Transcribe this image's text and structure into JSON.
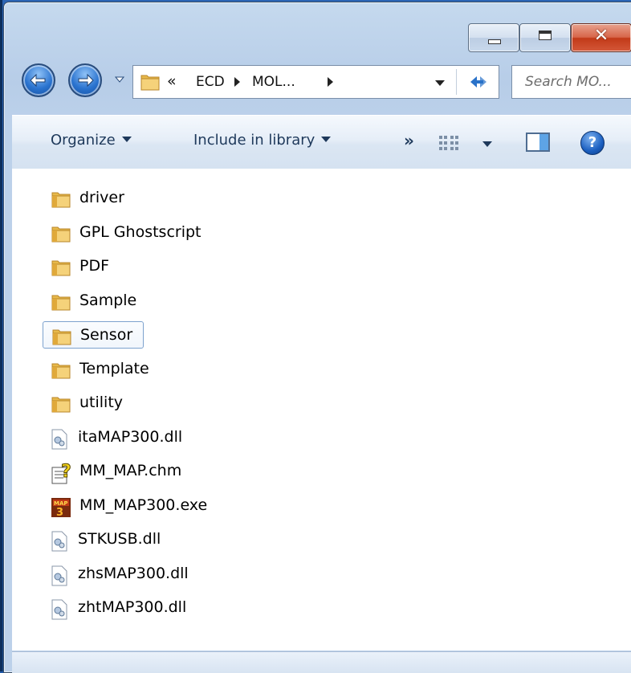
{
  "window": {
    "caption_buttons": {
      "minimize_icon": "minimize-icon",
      "maximize_icon": "maximize-icon",
      "close_label": "✕"
    }
  },
  "address_bar": {
    "overflow_chevron": "«",
    "crumbs": [
      "ECD",
      "MOL..."
    ],
    "refresh_icon": "refresh-icon"
  },
  "search": {
    "placeholder": "Search MO..."
  },
  "command_bar": {
    "organize": "Organize",
    "include_in_library": "Include in library",
    "more": "»",
    "help": "?"
  },
  "files": [
    {
      "name": "driver",
      "type": "folder"
    },
    {
      "name": "GPL Ghostscript",
      "type": "folder"
    },
    {
      "name": "PDF",
      "type": "folder"
    },
    {
      "name": "Sample",
      "type": "folder"
    },
    {
      "name": "Sensor",
      "type": "folder",
      "selected": true
    },
    {
      "name": "Template",
      "type": "folder"
    },
    {
      "name": "utility",
      "type": "folder"
    },
    {
      "name": "itaMAP300.dll",
      "type": "dll"
    },
    {
      "name": "MM_MAP.chm",
      "type": "chm"
    },
    {
      "name": "MM_MAP300.exe",
      "type": "exe"
    },
    {
      "name": "STKUSB.dll",
      "type": "dll"
    },
    {
      "name": "zhsMAP300.dll",
      "type": "dll"
    },
    {
      "name": "zhtMAP300.dll",
      "type": "dll"
    }
  ],
  "colors": {
    "selection_border": "#7da2ce",
    "command_text": "#1e395b",
    "close_button": "#c23a18"
  }
}
